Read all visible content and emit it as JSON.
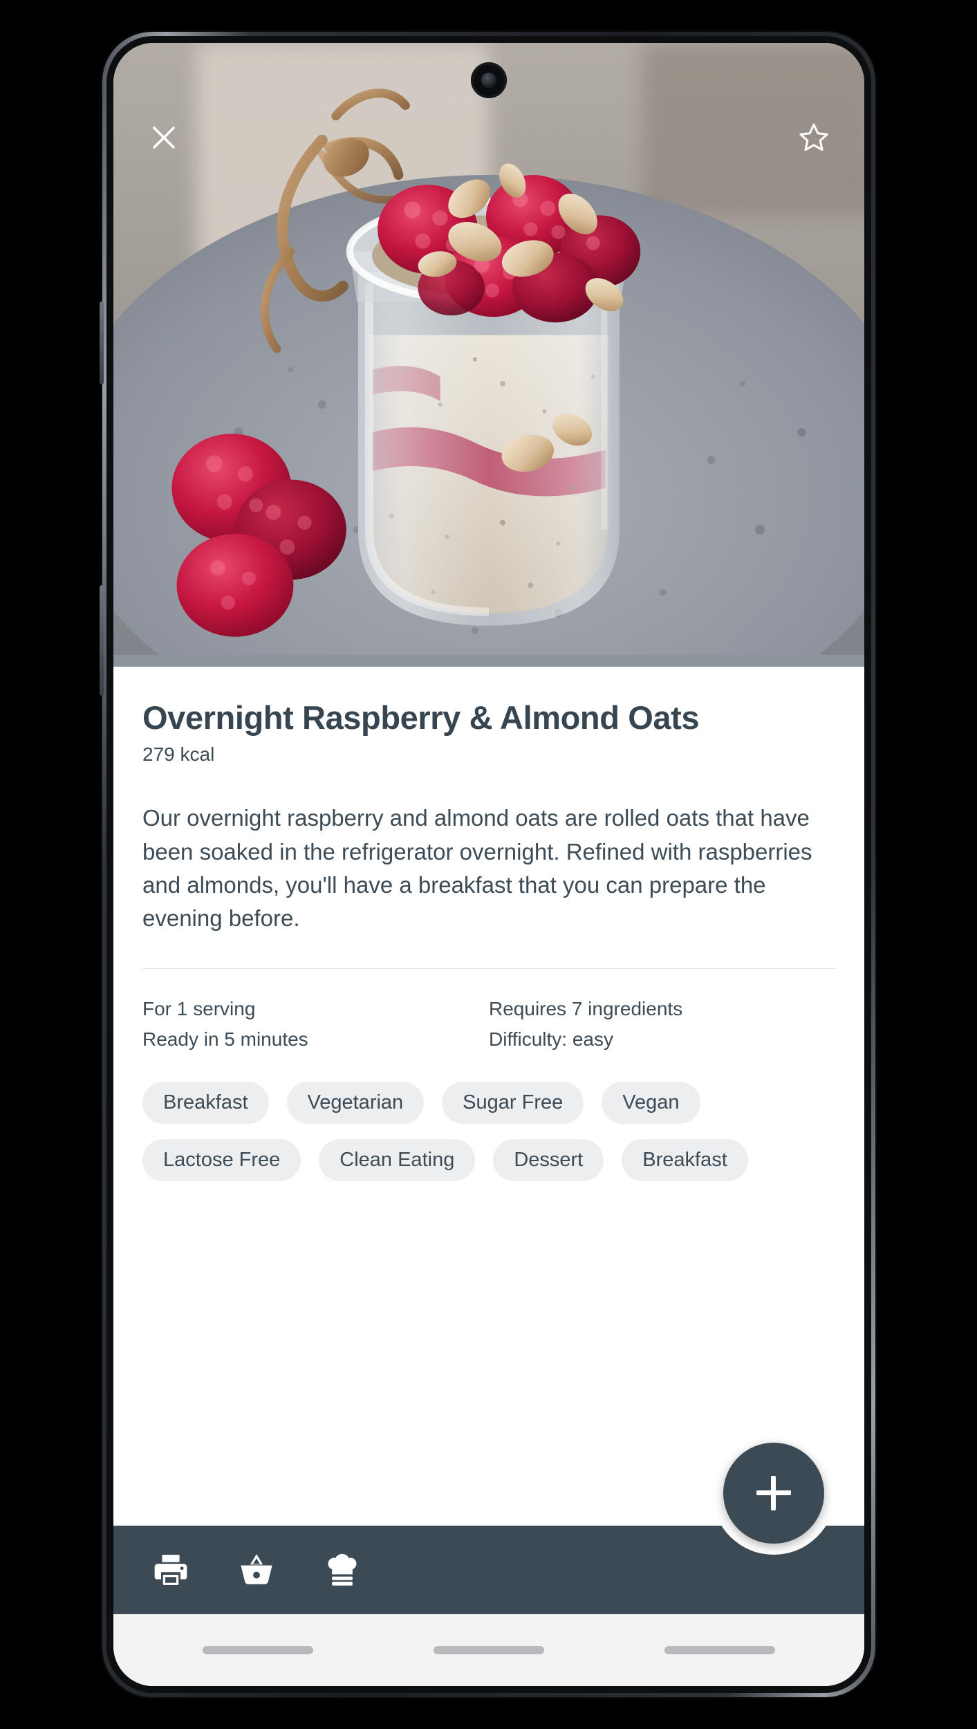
{
  "app": {
    "screen_name": "recipe-detail"
  },
  "hero": {
    "image_description": "Overnight oats in a glass jar topped with raspberries and chopped almonds on a grey speckled plate",
    "close_icon": "close-icon",
    "favorite_icon": "star-outline-icon"
  },
  "recipe": {
    "title": "Overnight Raspberry & Almond Oats",
    "calories": "279 kcal",
    "description": "Our overnight raspberry and almond oats are rolled oats that have been soaked in the refrigerator overnight. Refined with raspberries and almonds, you'll have a breakfast that you can prepare the evening before.",
    "meta_left": [
      "For 1 serving",
      "Ready in 5 minutes"
    ],
    "meta_right": [
      "Requires 7 ingredients",
      "Difficulty: easy"
    ],
    "tags": [
      "Breakfast",
      "Vegetarian",
      "Sugar Free",
      "Vegan",
      "Lactose Free",
      "Clean Eating",
      "Dessert",
      "Breakfast"
    ]
  },
  "fab": {
    "label": "+",
    "icon": "plus-icon",
    "color": "#3b4a54"
  },
  "bottom_bar": {
    "color": "#3b4a54",
    "items": [
      {
        "icon": "printer-icon",
        "name": "print"
      },
      {
        "icon": "shopping-basket-icon",
        "name": "shopping-list"
      },
      {
        "icon": "chef-hat-icon",
        "name": "cook-mode"
      }
    ]
  },
  "gesture_nav": {
    "pills": 3
  },
  "colors": {
    "accent": "#3b4a54",
    "text": "#3c4b55",
    "title": "#36454f",
    "tag_bg": "#eceef0",
    "card_bg": "#ffffff"
  }
}
